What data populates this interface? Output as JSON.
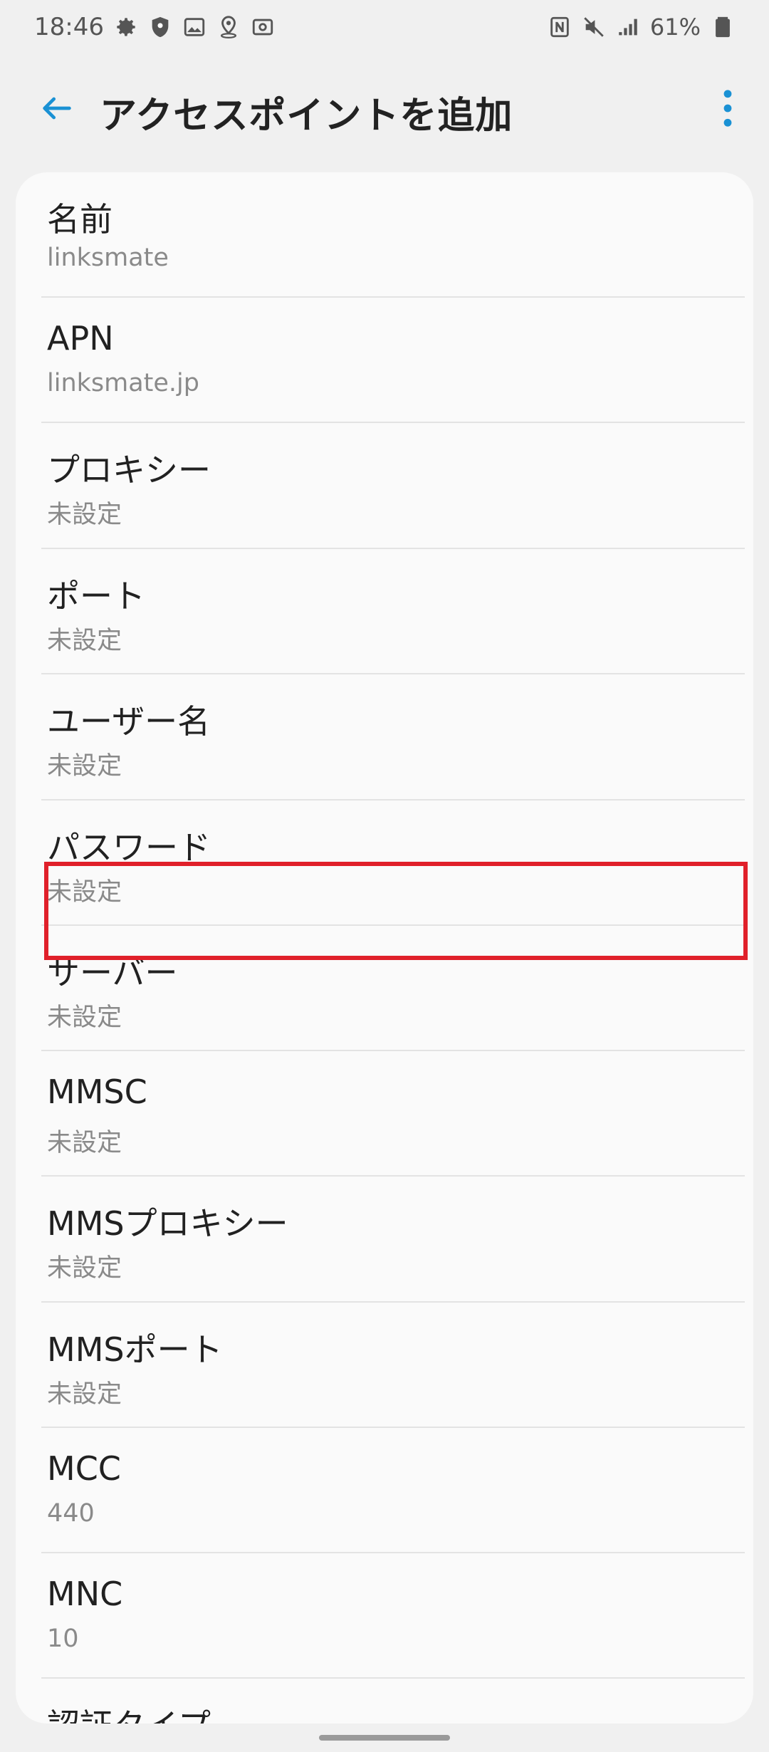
{
  "status_bar": {
    "time": "18:46",
    "left_icons": [
      "gear-icon",
      "shield-icon",
      "image-icon",
      "location-badge-icon",
      "screenshot-icon"
    ],
    "right_icons": [
      "nfc-icon",
      "mute-icon",
      "signal-icon"
    ],
    "battery_percent": "61%",
    "battery_icon": "battery-icon"
  },
  "app_bar": {
    "title": "アクセスポイントを追加",
    "back_icon": "arrow-back-icon",
    "overflow_icon": "more-vert-icon",
    "accent_color": "#1a91d4"
  },
  "items": [
    {
      "title": "名前",
      "summary": "linksmate"
    },
    {
      "title": "APN",
      "summary": "linksmate.jp"
    },
    {
      "title": "プロキシー",
      "summary": "未設定"
    },
    {
      "title": "ポート",
      "summary": "未設定"
    },
    {
      "title": "ユーザー名",
      "summary": "未設定"
    },
    {
      "title": "パスワード",
      "summary": "未設定"
    },
    {
      "title": "サーバー",
      "summary": "未設定"
    },
    {
      "title": "MMSC",
      "summary": "未設定"
    },
    {
      "title": "MMSプロキシー",
      "summary": "未設定"
    },
    {
      "title": "MMSポート",
      "summary": "未設定"
    },
    {
      "title": "MCC",
      "summary": "440"
    },
    {
      "title": "MNC",
      "summary": "10"
    },
    {
      "title": "認証タイプ",
      "summary": ""
    }
  ],
  "highlight_color": "#e0202a"
}
